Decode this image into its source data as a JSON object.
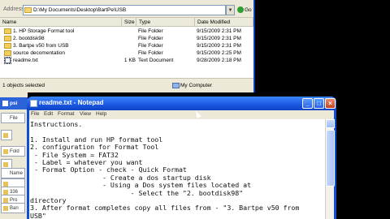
{
  "explorer": {
    "address_label": "Address",
    "address_value": "D:\\My Documents\\Desktop\\BartPe\\USB",
    "go_label": "Go",
    "columns": [
      "Name",
      "Size",
      "Type",
      "Date Modified"
    ],
    "rows": [
      {
        "name": "1. HP Storage Format tool",
        "size": "",
        "type": "File Folder",
        "date": "9/15/2009 2:31 PM",
        "icon": "folder-icon"
      },
      {
        "name": "2. bootdisk98",
        "size": "",
        "type": "File Folder",
        "date": "9/15/2009 2:31 PM",
        "icon": "folder-icon"
      },
      {
        "name": "3. Bartpe v50 from USB",
        "size": "",
        "type": "File Folder",
        "date": "9/15/2009 2:31 PM",
        "icon": "folder-icon"
      },
      {
        "name": "source decomentation",
        "size": "",
        "type": "File Folder",
        "date": "9/15/2009 2:25 PM",
        "icon": "folder-icon"
      },
      {
        "name": "readme.txt",
        "size": "1 KB",
        "type": "Text Document",
        "date": "9/28/2009 2:18 PM",
        "icon": "text-file-icon"
      }
    ],
    "status_left": "1 objects selected",
    "status_right": "My Computer"
  },
  "background_window": {
    "title": "psi",
    "side_items": [
      "File",
      "",
      "Fold",
      "",
      "",
      "Name",
      "",
      "336",
      "Pro",
      "Ban"
    ]
  },
  "notepad": {
    "title": "readme.txt - Notepad",
    "menus": [
      "File",
      "Edit",
      "Format",
      "View",
      "Help"
    ],
    "text": "Instructions.\n\n1. Install and run HP format tool\n2. configuration for Format Tool\n - File System = FAT32\n - Label = whatever you want\n - Format Option - check - Quick Format\n                  - Create a dos startup disk\n                  - Using a Dos system files located at\n                         - Select the \"2. bootdisk98\"\ndirectory\n3. After format completes copy all files from - \"3. Bartpe v50 from\nUSB\""
  }
}
